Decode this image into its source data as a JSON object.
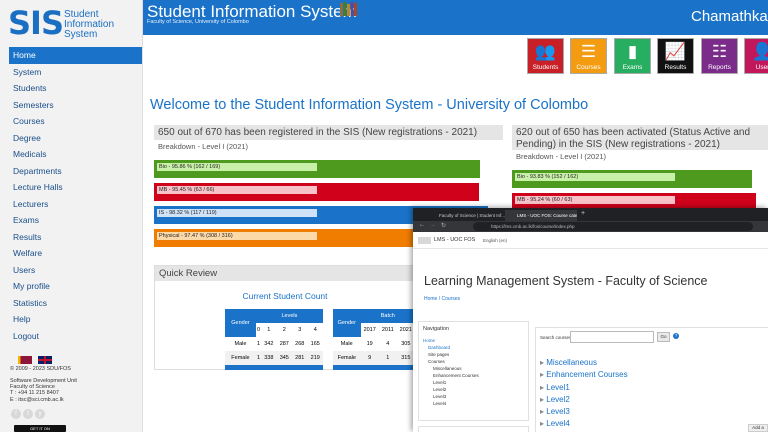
{
  "sidebar": {
    "logo_mark": "SIS",
    "logo_text": [
      "Student",
      "Information",
      "System"
    ],
    "items": [
      {
        "label": "Home",
        "active": true
      },
      {
        "label": "System"
      },
      {
        "label": "Students"
      },
      {
        "label": "Semesters"
      },
      {
        "label": "Courses"
      },
      {
        "label": "Degree"
      },
      {
        "label": "Medicals"
      },
      {
        "label": "Departments"
      },
      {
        "label": "Lecture Halls"
      },
      {
        "label": "Lecturers"
      },
      {
        "label": "Exams"
      },
      {
        "label": "Results"
      },
      {
        "label": "Welfare"
      },
      {
        "label": "Users"
      },
      {
        "label": "My profile"
      },
      {
        "label": "Statistics"
      },
      {
        "label": "Help"
      },
      {
        "label": "Logout"
      }
    ],
    "copyright": "© 2009 - 2023 SDU/FOS",
    "unit": [
      "Software Development Unit",
      "Faculty of Science"
    ],
    "tel": "T : +94 11 215 8407",
    "email": "E : itsc@sci.cmb.ac.lk",
    "social": [
      "f",
      "t",
      "y"
    ],
    "store_badge": "GET IT ON"
  },
  "header": {
    "title": "Student Information System",
    "subtitle": "Faculty of Science, University of Colombo",
    "user": "Chamathka C"
  },
  "tiles": [
    {
      "label": "Students",
      "icon": "students-icon",
      "glyph": "👥",
      "color": "#c91f27"
    },
    {
      "label": "Courses",
      "icon": "courses-icon",
      "glyph": "☰",
      "color": "#f39c12"
    },
    {
      "label": "Exams",
      "icon": "exams-icon",
      "glyph": "▮",
      "color": "#27ae60"
    },
    {
      "label": "Results",
      "icon": "results-icon",
      "glyph": "📈",
      "color": "#111111"
    },
    {
      "label": "Reports",
      "icon": "reports-icon",
      "glyph": "☷",
      "color": "#7b2c8b"
    },
    {
      "label": "User",
      "icon": "user-icon",
      "glyph": "👤",
      "color": "#c2185b"
    }
  ],
  "welcome": "Welcome to the Student Information System - University of Colombo",
  "registered_panel": {
    "title": "650 out of 670 has been registered in the SIS (New registrations - 2021)",
    "breakdown": "Breakdown - Level I (2021)",
    "bars": [
      {
        "label": "Bio - 95.86 % (162 / 169)",
        "value": 95.86,
        "color": "#4e9a1e",
        "inner": "#c8f0a8"
      },
      {
        "label": "MB - 95.45 % (63 / 66)",
        "value": 95.45,
        "color": "#d0021b",
        "inner": "#f7c3c9"
      },
      {
        "label": "IS - 98.32 % (117 / 119)",
        "value": 98.32,
        "color": "#1a73c9",
        "inner": "#cfe2f7"
      },
      {
        "label": "Physical - 97.47 % (308 / 316)",
        "value": 97.47,
        "color": "#f07c00",
        "inner": "#fbd9a8"
      }
    ]
  },
  "activated_panel": {
    "title": "620 out of 650 has been activated (Status Active and Pending) in the SIS (New registrations - 2021)",
    "breakdown": "Breakdown - Level I (2021)",
    "bars": [
      {
        "label": "Bio - 93.83 % (152 / 162)",
        "value": 93.83,
        "color": "#4e9a1e",
        "inner": "#c8f0a8"
      },
      {
        "label": "MB - 95.24 % (60 / 63)",
        "value": 95.24,
        "color": "#d0021b",
        "inner": "#f7c3c9"
      }
    ]
  },
  "quick_review": {
    "title": "Quick Review",
    "count_title": "Current Student Count",
    "levels_table": {
      "headers": [
        "Gender",
        "Levels"
      ],
      "subheaders": [
        "",
        "0",
        "1",
        "2",
        "3",
        "4"
      ],
      "rows": [
        [
          "Male",
          "1",
          "342",
          "287",
          "268",
          "165"
        ],
        [
          "Female",
          "1",
          "338",
          "345",
          "281",
          "219"
        ]
      ]
    },
    "batch_table": {
      "headers": [
        "Gender",
        "Batch"
      ],
      "subheaders": [
        "",
        "2017",
        "2011",
        "2021"
      ],
      "rows": [
        [
          "Male",
          "19",
          "4",
          "305"
        ],
        [
          "Female",
          "9",
          "1",
          "315"
        ]
      ]
    }
  },
  "lms": {
    "tabs": [
      "Faculty of Science | Student Inf...",
      "LMS - UOC FOS: Course categ..."
    ],
    "url": "https://lms.cmb.ac.lk/fos/course/index.php",
    "site_name": "LMS - UOC FOS",
    "language": "English (en)",
    "title": "Learning Management System - Faculty of Science",
    "breadcrumb": "Home / Courses",
    "navigation_title": "Navigation",
    "tree": [
      {
        "label": "Home",
        "link": true
      },
      {
        "label": "Dashboard",
        "link": true
      },
      {
        "label": "Site pages",
        "link": false
      },
      {
        "label": "Courses",
        "link": false
      },
      {
        "label": "Miscellaneous",
        "link": false
      },
      {
        "label": "Enhancement Courses",
        "link": false
      },
      {
        "label": "Level1",
        "link": false
      },
      {
        "label": "Level2",
        "link": false
      },
      {
        "label": "Level3",
        "link": false
      },
      {
        "label": "Level4",
        "link": false
      }
    ],
    "search_label": "Search courses",
    "go": "Go",
    "categories": [
      "Miscellaneous",
      "Enhancement Courses",
      "Level1",
      "Level2",
      "Level3",
      "Level4"
    ],
    "add_label": "Add a"
  }
}
